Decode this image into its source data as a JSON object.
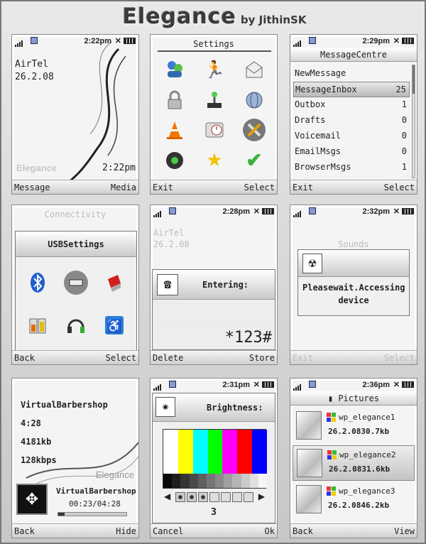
{
  "header": {
    "title": "Elegance",
    "byline": "by JithinSK"
  },
  "screens": {
    "standby": {
      "status_time": "2:22pm",
      "operator": "AirTel",
      "date": "26.2.08",
      "watermark": "Elegance",
      "clock": "2:22pm",
      "soft_left": "Message",
      "soft_right": "Media"
    },
    "settings": {
      "title": "Settings",
      "icons": [
        "people-icon",
        "runner-icon",
        "envelope-icon",
        "lock-icon",
        "joystick-icon",
        "globe-icon",
        "cone-icon",
        "clock-icon",
        "tools-icon",
        "speaker-icon",
        "star-icon",
        "check-icon"
      ],
      "soft_left": "Exit",
      "soft_right": "Select"
    },
    "messages": {
      "status_time": "2:29pm",
      "title": "MessageCentre",
      "items": [
        {
          "label": "NewMessage",
          "count": ""
        },
        {
          "label": "MessageInbox",
          "count": "25"
        },
        {
          "label": "Outbox",
          "count": "1"
        },
        {
          "label": "Drafts",
          "count": "0"
        },
        {
          "label": "Voicemail",
          "count": "0"
        },
        {
          "label": "EmailMsgs",
          "count": "0"
        },
        {
          "label": "BrowserMsgs",
          "count": "1"
        }
      ],
      "soft_left": "Exit",
      "soft_right": "Select"
    },
    "connectivity": {
      "title": "Connectivity",
      "dialog_title": "USBSettings",
      "icons": [
        "bluetooth-icon",
        "usb-icon",
        "infrared-icon",
        "battery-icon",
        "headset-icon",
        "accessibility-icon"
      ],
      "soft_left": "Back",
      "soft_right": "Select"
    },
    "dialer": {
      "status_time": "2:28pm",
      "operator": "AirTel",
      "date": "26.2.08",
      "label": "Entering:",
      "value": "*123#",
      "soft_left": "Delete",
      "soft_right": "Store"
    },
    "sounds": {
      "status_time": "2:32pm",
      "title": "Sounds",
      "message": "Pleasewait.Accessing device",
      "soft_left": "Exit",
      "soft_right": "Select"
    },
    "player": {
      "track": "VirtualBarbershop",
      "length": "4:28",
      "size": "4181kb",
      "bitrate": "128kbps",
      "watermark": "Elegance",
      "now_title": "VirtualBarbershop",
      "progress": "00:23/04:28",
      "progress_fraction": 0.09,
      "soft_left": "Back",
      "soft_right": "Hide"
    },
    "brightness": {
      "status_time": "2:31pm",
      "title": "Brightness:",
      "level": "3",
      "level_fraction": 0.43,
      "bar_colors": [
        "#ffffff",
        "#ffff00",
        "#00ffff",
        "#00ff00",
        "#ff00ff",
        "#ff0000",
        "#0000ff"
      ],
      "soft_left": "Cancel",
      "soft_right": "Ok"
    },
    "pictures": {
      "status_time": "2:36pm",
      "title": "Pictures",
      "items": [
        {
          "name": "wp_elegance1",
          "meta": "26.2.0830.7kb"
        },
        {
          "name": "wp_elegance2",
          "meta": "26.2.0831.6kb"
        },
        {
          "name": "wp_elegance3",
          "meta": "26.2.0846.2kb"
        }
      ],
      "soft_left": "Back",
      "soft_right": "View"
    }
  }
}
